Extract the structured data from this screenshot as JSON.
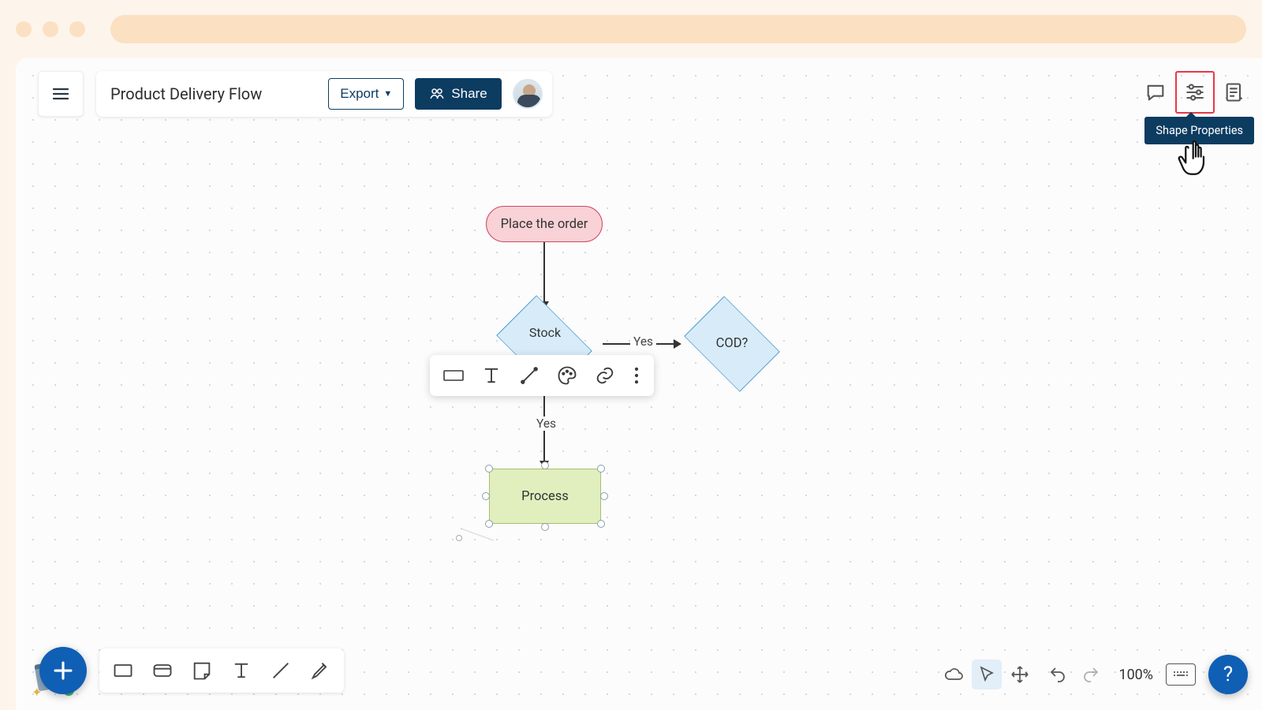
{
  "browser": {},
  "header": {
    "doc_title": "Product Delivery Flow",
    "export_label": "Export",
    "share_label": "Share"
  },
  "top_right": {
    "tooltip": "Shape Properties"
  },
  "flow": {
    "start": "Place the order",
    "decision1": "Stock",
    "decision2": "COD?",
    "process": "Process",
    "edge_yes_h": "Yes",
    "edge_yes_v": "Yes"
  },
  "footer": {
    "zoom": "100%",
    "help": "?"
  },
  "chart_data": {
    "type": "flowchart",
    "nodes": [
      {
        "id": "n1",
        "kind": "terminator",
        "label": "Place the order",
        "fill": "#f8d2d6",
        "stroke": "#d0475e"
      },
      {
        "id": "n2",
        "kind": "decision",
        "label": "Stock",
        "fill": "#d7ecf8",
        "stroke": "#4f9acc"
      },
      {
        "id": "n3",
        "kind": "decision",
        "label": "COD?",
        "fill": "#d7ecf8",
        "stroke": "#4f9acc"
      },
      {
        "id": "n4",
        "kind": "process",
        "label": "Process",
        "fill": "#e1efbe",
        "stroke": "#a9bf6d",
        "selected": true
      }
    ],
    "edges": [
      {
        "from": "n1",
        "to": "n2",
        "label": ""
      },
      {
        "from": "n2",
        "to": "n3",
        "label": "Yes"
      },
      {
        "from": "n2",
        "to": "n4",
        "label": "Yes"
      }
    ]
  }
}
